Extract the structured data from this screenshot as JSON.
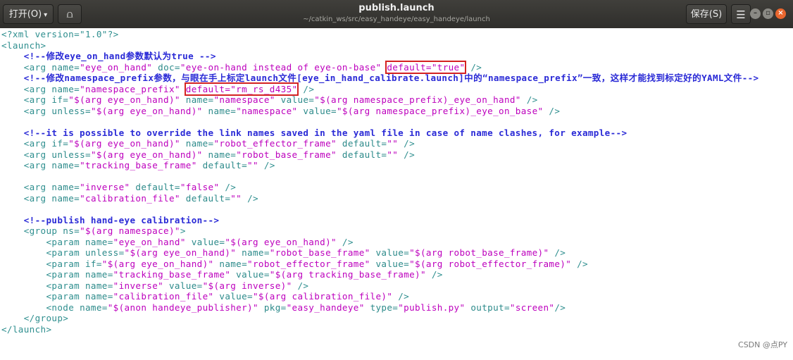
{
  "toolbar": {
    "open_label": "打开(O)",
    "open_caret": "▾",
    "pin_icon": "⩍",
    "save_label": "保存(S)",
    "menu_icon": "☰"
  },
  "window": {
    "title": "publish.launch",
    "path": "~/catkin_ws/src/easy_handeye/easy_handeye/launch",
    "min_icon": "–",
    "max_icon": "▫",
    "close_icon": "×"
  },
  "code_lines": [
    [
      {
        "k": "t",
        "s": "<?xml version=\"1.0\"?>"
      }
    ],
    [
      {
        "k": "t",
        "s": "<launch>"
      }
    ],
    [
      {
        "k": "p",
        "s": "    "
      },
      {
        "k": "c",
        "s": "<!--修改eye_on_hand参数默认为true -->"
      }
    ],
    [
      {
        "k": "p",
        "s": "    "
      },
      {
        "k": "t",
        "s": "<arg "
      },
      {
        "k": "a",
        "s": "name="
      },
      {
        "k": "v",
        "s": "\"eye_on_hand\""
      },
      {
        "k": "a",
        "s": " doc="
      },
      {
        "k": "v",
        "s": "\"eye-on-hand instead of eye-on-base\""
      },
      {
        "k": "p",
        "s": " "
      },
      {
        "k": "hl",
        "s": "default=\"true\""
      },
      {
        "k": "p",
        "s": " "
      },
      {
        "k": "t",
        "s": "/>"
      }
    ],
    [
      {
        "k": "p",
        "s": "    "
      },
      {
        "k": "c",
        "s": "<!--修改namespace_prefix参数，与眼在手上标定launch文件[eye_in_hand_calibrate.launch]中的“namespace_prefix”一致，这样才能找到标定好的YAML文件-->"
      }
    ],
    [
      {
        "k": "p",
        "s": "    "
      },
      {
        "k": "t",
        "s": "<arg "
      },
      {
        "k": "a",
        "s": "name="
      },
      {
        "k": "v",
        "s": "\"namespace_prefix\""
      },
      {
        "k": "p",
        "s": " "
      },
      {
        "k": "hl",
        "s": "default=\"rm_rs_d435\""
      },
      {
        "k": "p",
        "s": " "
      },
      {
        "k": "t",
        "s": "/>"
      }
    ],
    [
      {
        "k": "p",
        "s": "    "
      },
      {
        "k": "t",
        "s": "<arg "
      },
      {
        "k": "a",
        "s": "if="
      },
      {
        "k": "v",
        "s": "\"$(arg eye_on_hand)\""
      },
      {
        "k": "a",
        "s": " name="
      },
      {
        "k": "v",
        "s": "\"namespace\""
      },
      {
        "k": "a",
        "s": " value="
      },
      {
        "k": "v",
        "s": "\"$(arg namespace_prefix)_eye_on_hand\""
      },
      {
        "k": "p",
        "s": " "
      },
      {
        "k": "t",
        "s": "/>"
      }
    ],
    [
      {
        "k": "p",
        "s": "    "
      },
      {
        "k": "t",
        "s": "<arg "
      },
      {
        "k": "a",
        "s": "unless="
      },
      {
        "k": "v",
        "s": "\"$(arg eye_on_hand)\""
      },
      {
        "k": "a",
        "s": " name="
      },
      {
        "k": "v",
        "s": "\"namespace\""
      },
      {
        "k": "a",
        "s": " value="
      },
      {
        "k": "v",
        "s": "\"$(arg namespace_prefix)_eye_on_base\""
      },
      {
        "k": "p",
        "s": " "
      },
      {
        "k": "t",
        "s": "/>"
      }
    ],
    [],
    [
      {
        "k": "p",
        "s": "    "
      },
      {
        "k": "c",
        "s": "<!--it is possible to override the link names saved in the yaml file in case of name clashes, for example-->"
      }
    ],
    [
      {
        "k": "p",
        "s": "    "
      },
      {
        "k": "t",
        "s": "<arg "
      },
      {
        "k": "a",
        "s": "if="
      },
      {
        "k": "v",
        "s": "\"$(arg eye_on_hand)\""
      },
      {
        "k": "a",
        "s": " name="
      },
      {
        "k": "v",
        "s": "\"robot_effector_frame\""
      },
      {
        "k": "a",
        "s": " default="
      },
      {
        "k": "v",
        "s": "\"\""
      },
      {
        "k": "p",
        "s": " "
      },
      {
        "k": "t",
        "s": "/>"
      }
    ],
    [
      {
        "k": "p",
        "s": "    "
      },
      {
        "k": "t",
        "s": "<arg "
      },
      {
        "k": "a",
        "s": "unless="
      },
      {
        "k": "v",
        "s": "\"$(arg eye_on_hand)\""
      },
      {
        "k": "a",
        "s": " name="
      },
      {
        "k": "v",
        "s": "\"robot_base_frame\""
      },
      {
        "k": "a",
        "s": " default="
      },
      {
        "k": "v",
        "s": "\"\""
      },
      {
        "k": "p",
        "s": " "
      },
      {
        "k": "t",
        "s": "/>"
      }
    ],
    [
      {
        "k": "p",
        "s": "    "
      },
      {
        "k": "t",
        "s": "<arg "
      },
      {
        "k": "a",
        "s": "name="
      },
      {
        "k": "v",
        "s": "\"tracking_base_frame\""
      },
      {
        "k": "a",
        "s": " default="
      },
      {
        "k": "v",
        "s": "\"\""
      },
      {
        "k": "p",
        "s": " "
      },
      {
        "k": "t",
        "s": "/>"
      }
    ],
    [],
    [
      {
        "k": "p",
        "s": "    "
      },
      {
        "k": "t",
        "s": "<arg "
      },
      {
        "k": "a",
        "s": "name="
      },
      {
        "k": "v",
        "s": "\"inverse\""
      },
      {
        "k": "a",
        "s": " default="
      },
      {
        "k": "v",
        "s": "\"false\""
      },
      {
        "k": "p",
        "s": " "
      },
      {
        "k": "t",
        "s": "/>"
      }
    ],
    [
      {
        "k": "p",
        "s": "    "
      },
      {
        "k": "t",
        "s": "<arg "
      },
      {
        "k": "a",
        "s": "name="
      },
      {
        "k": "v",
        "s": "\"calibration_file\""
      },
      {
        "k": "a",
        "s": " default="
      },
      {
        "k": "v",
        "s": "\"\""
      },
      {
        "k": "p",
        "s": " "
      },
      {
        "k": "t",
        "s": "/>"
      }
    ],
    [],
    [
      {
        "k": "p",
        "s": "    "
      },
      {
        "k": "c",
        "s": "<!--publish hand-eye calibration-->"
      }
    ],
    [
      {
        "k": "p",
        "s": "    "
      },
      {
        "k": "t",
        "s": "<group "
      },
      {
        "k": "a",
        "s": "ns="
      },
      {
        "k": "v",
        "s": "\"$(arg namespace)\""
      },
      {
        "k": "t",
        "s": ">"
      }
    ],
    [
      {
        "k": "p",
        "s": "        "
      },
      {
        "k": "t",
        "s": "<param "
      },
      {
        "k": "a",
        "s": "name="
      },
      {
        "k": "v",
        "s": "\"eye_on_hand\""
      },
      {
        "k": "a",
        "s": " value="
      },
      {
        "k": "v",
        "s": "\"$(arg eye_on_hand)\""
      },
      {
        "k": "p",
        "s": " "
      },
      {
        "k": "t",
        "s": "/>"
      }
    ],
    [
      {
        "k": "p",
        "s": "        "
      },
      {
        "k": "t",
        "s": "<param "
      },
      {
        "k": "a",
        "s": "unless="
      },
      {
        "k": "v",
        "s": "\"$(arg eye_on_hand)\""
      },
      {
        "k": "a",
        "s": " name="
      },
      {
        "k": "v",
        "s": "\"robot_base_frame\""
      },
      {
        "k": "a",
        "s": " value="
      },
      {
        "k": "v",
        "s": "\"$(arg robot_base_frame)\""
      },
      {
        "k": "p",
        "s": " "
      },
      {
        "k": "t",
        "s": "/>"
      }
    ],
    [
      {
        "k": "p",
        "s": "        "
      },
      {
        "k": "t",
        "s": "<param "
      },
      {
        "k": "a",
        "s": "if="
      },
      {
        "k": "v",
        "s": "\"$(arg eye_on_hand)\""
      },
      {
        "k": "a",
        "s": " name="
      },
      {
        "k": "v",
        "s": "\"robot_effector_frame\""
      },
      {
        "k": "a",
        "s": " value="
      },
      {
        "k": "v",
        "s": "\"$(arg robot_effector_frame)\""
      },
      {
        "k": "p",
        "s": " "
      },
      {
        "k": "t",
        "s": "/>"
      }
    ],
    [
      {
        "k": "p",
        "s": "        "
      },
      {
        "k": "t",
        "s": "<param "
      },
      {
        "k": "a",
        "s": "name="
      },
      {
        "k": "v",
        "s": "\"tracking_base_frame\""
      },
      {
        "k": "a",
        "s": " value="
      },
      {
        "k": "v",
        "s": "\"$(arg tracking_base_frame)\""
      },
      {
        "k": "p",
        "s": " "
      },
      {
        "k": "t",
        "s": "/>"
      }
    ],
    [
      {
        "k": "p",
        "s": "        "
      },
      {
        "k": "t",
        "s": "<param "
      },
      {
        "k": "a",
        "s": "name="
      },
      {
        "k": "v",
        "s": "\"inverse\""
      },
      {
        "k": "a",
        "s": " value="
      },
      {
        "k": "v",
        "s": "\"$(arg inverse)\""
      },
      {
        "k": "p",
        "s": " "
      },
      {
        "k": "t",
        "s": "/>"
      }
    ],
    [
      {
        "k": "p",
        "s": "        "
      },
      {
        "k": "t",
        "s": "<param "
      },
      {
        "k": "a",
        "s": "name="
      },
      {
        "k": "v",
        "s": "\"calibration_file\""
      },
      {
        "k": "a",
        "s": " value="
      },
      {
        "k": "v",
        "s": "\"$(arg calibration_file)\""
      },
      {
        "k": "p",
        "s": " "
      },
      {
        "k": "t",
        "s": "/>"
      }
    ],
    [
      {
        "k": "p",
        "s": "        "
      },
      {
        "k": "t",
        "s": "<node "
      },
      {
        "k": "a",
        "s": "name="
      },
      {
        "k": "v",
        "s": "\"$(anon handeye_publisher)\""
      },
      {
        "k": "a",
        "s": " pkg="
      },
      {
        "k": "v",
        "s": "\"easy_handeye\""
      },
      {
        "k": "a",
        "s": " type="
      },
      {
        "k": "v",
        "s": "\"publish.py\""
      },
      {
        "k": "a",
        "s": " output="
      },
      {
        "k": "v",
        "s": "\"screen\""
      },
      {
        "k": "t",
        "s": "/>"
      }
    ],
    [
      {
        "k": "p",
        "s": "    "
      },
      {
        "k": "t",
        "s": "</group>"
      }
    ],
    [
      {
        "k": "t",
        "s": "</launch>"
      }
    ]
  ],
  "watermark": "CSDN @点PY",
  "colors": {
    "tag": "#2f8f8f",
    "value": "#bd00bd",
    "comment": "#2a2ad6",
    "highlight_box": "#d42222",
    "titlebar": "#3a3936"
  }
}
